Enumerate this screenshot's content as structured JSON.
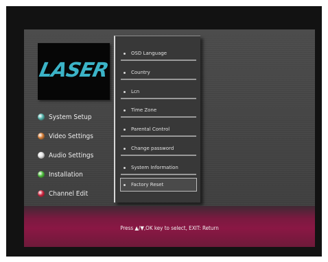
{
  "brand": {
    "logo_text": "LASER",
    "logo_color": "#3bb3c7"
  },
  "sidebar": {
    "items": [
      {
        "label": "System Setup",
        "dot_color": "#58b8b0"
      },
      {
        "label": "Video Settings",
        "dot_color": "#d9813a"
      },
      {
        "label": "Audio Settings",
        "dot_color": "#e6e6e6"
      },
      {
        "label": "Installation",
        "dot_color": "#4fbf3e"
      },
      {
        "label": "Channel Edit",
        "dot_color": "#d32a44"
      }
    ]
  },
  "submenu": {
    "selected_index": 7,
    "items": [
      {
        "label": "OSD Language"
      },
      {
        "label": "Country"
      },
      {
        "label": "Lcn"
      },
      {
        "label": "Time Zone"
      },
      {
        "label": "Parental Control"
      },
      {
        "label": "Change password"
      },
      {
        "label": "System Information"
      },
      {
        "label": "Factory Reset"
      }
    ]
  },
  "footer": {
    "hint": "Press ▲/▼,OK key to select, EXIT: Return"
  }
}
